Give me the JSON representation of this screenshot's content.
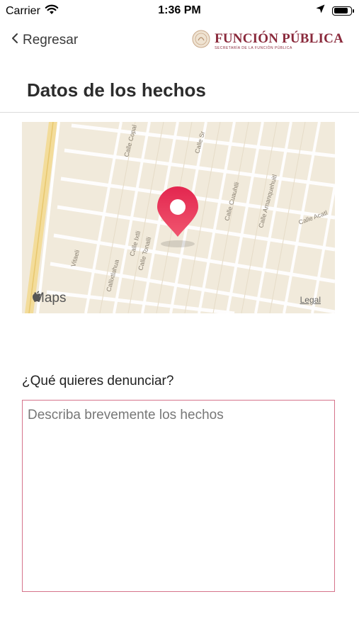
{
  "status_bar": {
    "carrier": "Carrier",
    "time": "1:36 PM",
    "battery_level": 0.9
  },
  "nav": {
    "back_label": "Regresar",
    "brand_title": "FUNCIÓN PÚBLICA",
    "brand_subtitle": "SECRETARÍA DE LA FUNCIÓN PÚBLICA"
  },
  "page": {
    "title": "Datos de los hechos"
  },
  "map": {
    "provider_label": "Maps",
    "legal_label": "Legal",
    "street_labels": [
      "Calle Copal",
      "Calle Sr",
      "Calle Cuauhtli",
      "Calle Amanquehuitl",
      "Calle Acatl",
      "Calle Tonalli",
      "Callixtlahua",
      "Calle Ixtli",
      "Vitaeli"
    ],
    "pin_color": "#e0224f",
    "background_color": "#f1eadb"
  },
  "form": {
    "question_label": "¿Qué quieres denunciar?",
    "description_placeholder": "Describa brevemente los hechos",
    "description_value": "",
    "accent_color": "#d6738b"
  }
}
